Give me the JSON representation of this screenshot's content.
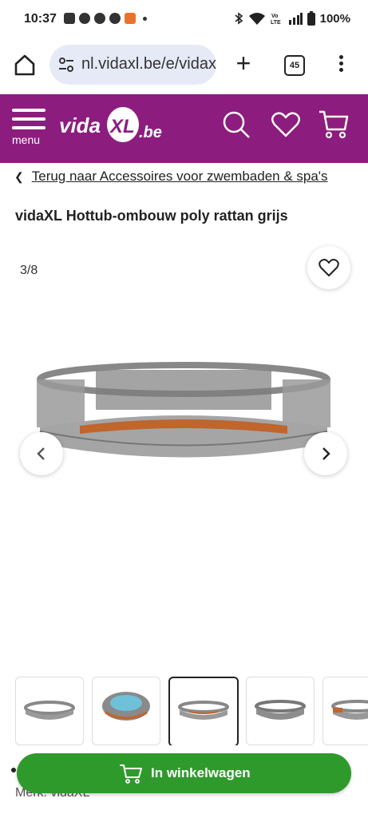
{
  "status_bar": {
    "time": "10:37",
    "battery": "100%",
    "icons": [
      "chat-icon",
      "facebook-icon",
      "facebook-icon",
      "messenger-icon",
      "app-icon",
      "bluetooth-icon",
      "wifi-icon",
      "volte-icon",
      "signal-icon",
      "battery-icon"
    ]
  },
  "browser": {
    "url": "nl.vidaxl.be/e/vidaxl",
    "tab_count": "45"
  },
  "site_header": {
    "menu_label": "menu",
    "logo_text": "vidaXL.be",
    "brand_color": "#8c1d7e"
  },
  "breadcrumb": {
    "link_text": "Terug naar Accessoires voor zwembaden & spa's"
  },
  "product": {
    "title": "vidaXL Hottub-ombouw poly rattan grijs",
    "image_counter": "3/8",
    "thumbnails_count": 5,
    "active_thumbnail": 3,
    "brand_line": "Merk: vidaXL"
  },
  "cart_button": {
    "label": "In winkelwagen",
    "color": "#2f9a2c"
  }
}
